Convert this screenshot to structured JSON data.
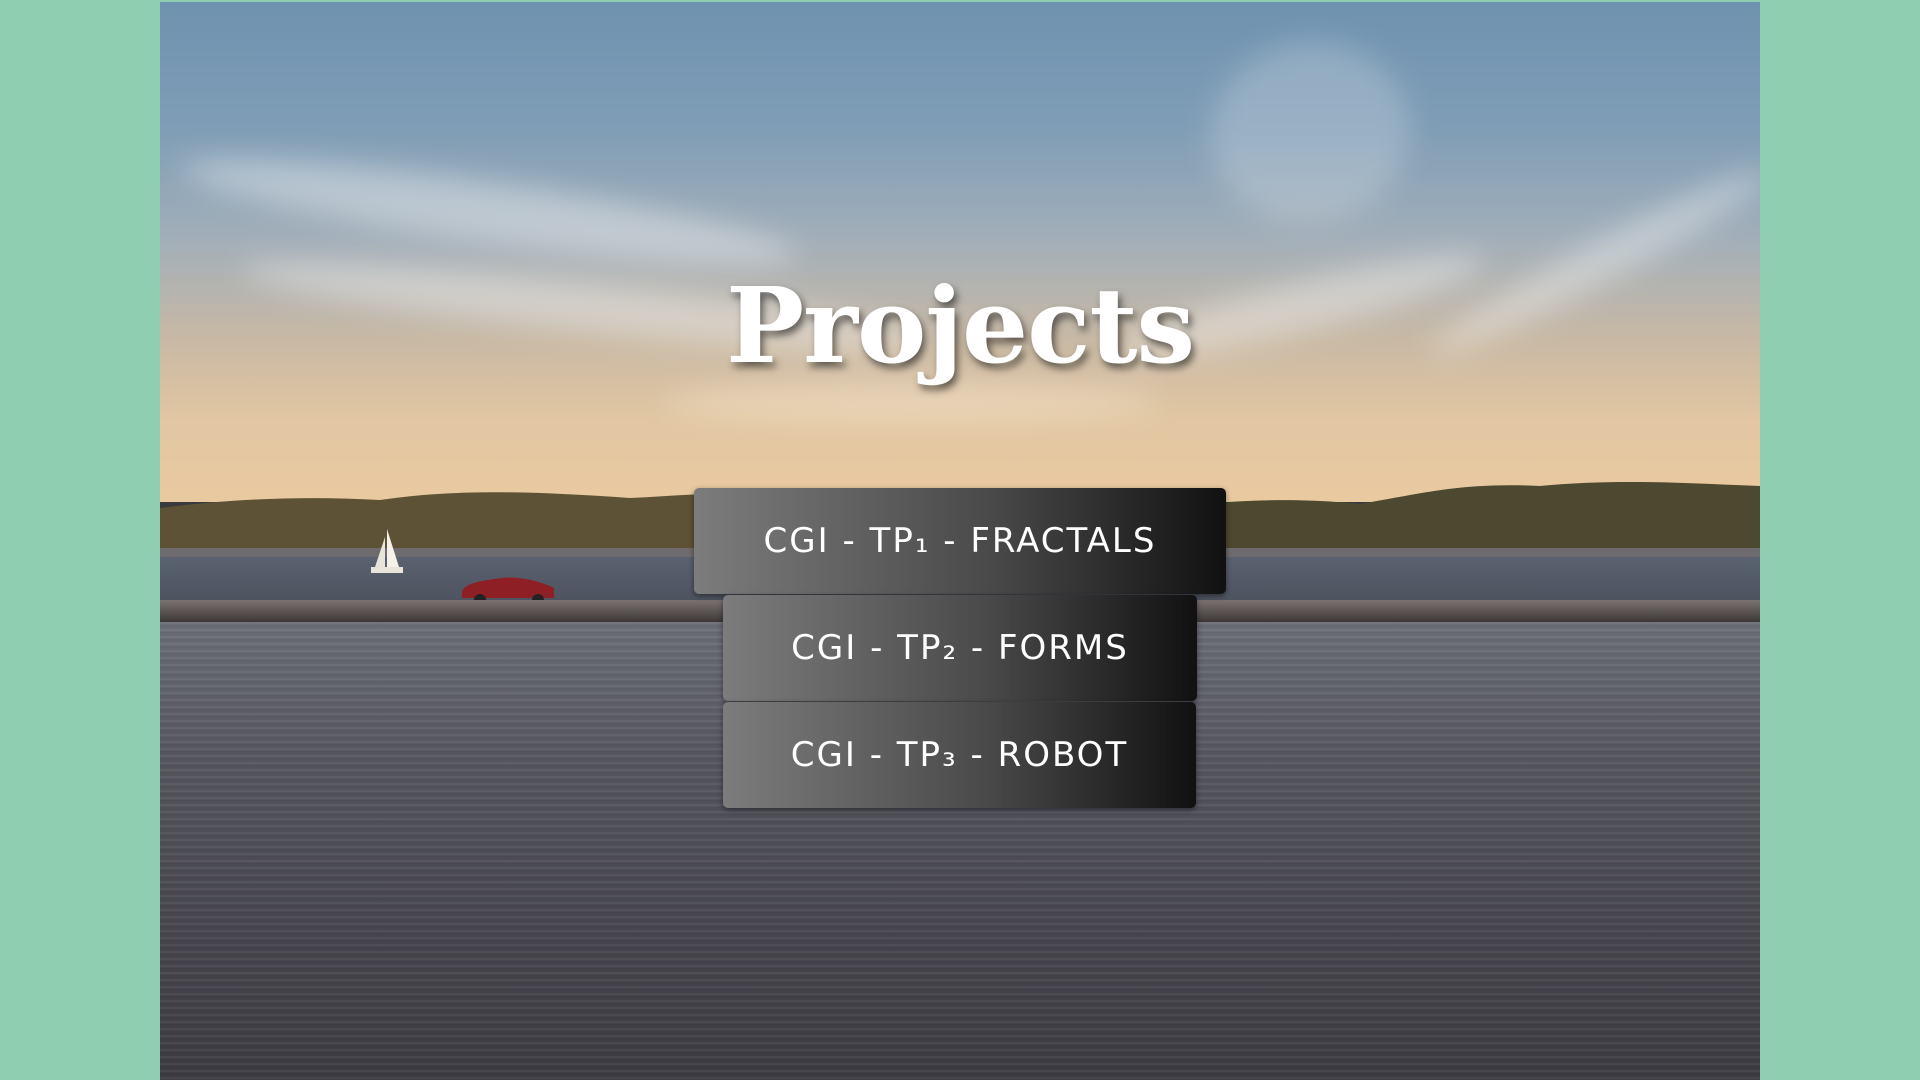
{
  "page": {
    "background_color": "#8fceb0",
    "title": "Projects"
  },
  "menu": {
    "items": [
      {
        "label": "CGI - TP₁ - FRACTALS"
      },
      {
        "label": "CGI - TP₂ - FORMS"
      },
      {
        "label": "CGI - TP₃ - ROBOT"
      }
    ]
  },
  "colors": {
    "button_gradient_start": "#7c7c7c",
    "button_gradient_end": "#111111",
    "text": "#ffffff"
  }
}
